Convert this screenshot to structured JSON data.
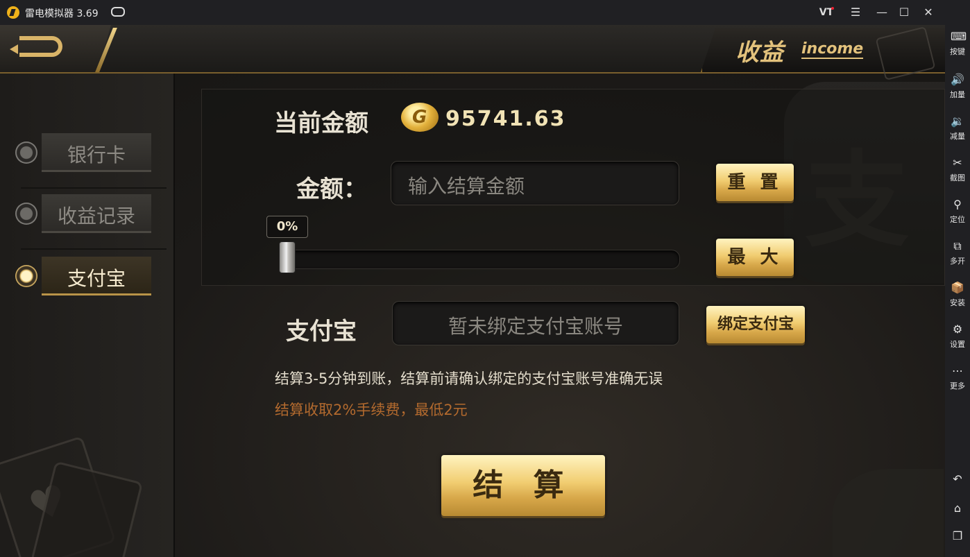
{
  "window": {
    "title": "雷电模拟器 3.69",
    "vt_label": "VT"
  },
  "sidebar": {
    "items": [
      {
        "label": "按键",
        "icon": "keyboard-icon"
      },
      {
        "label": "加量",
        "icon": "volume-up-icon"
      },
      {
        "label": "减量",
        "icon": "volume-down-icon"
      },
      {
        "label": "截图",
        "icon": "scissors-icon"
      },
      {
        "label": "定位",
        "icon": "location-pin-icon"
      },
      {
        "label": "多开",
        "icon": "multi-instance-icon"
      },
      {
        "label": "安装",
        "icon": "apk-install-icon"
      },
      {
        "label": "设置",
        "icon": "gear-icon"
      },
      {
        "label": "更多",
        "icon": "more-dots-icon"
      }
    ],
    "nav": [
      "back-icon",
      "home-icon",
      "recent-apps-icon"
    ]
  },
  "header": {
    "title_cn": "收益",
    "title_en": "income"
  },
  "tabs": [
    {
      "label": "银行卡",
      "active": false
    },
    {
      "label": "收益记录",
      "active": false
    },
    {
      "label": "支付宝",
      "active": true
    }
  ],
  "watermark_char": "支",
  "balance": {
    "label": "当前金额",
    "value": "95741.63"
  },
  "amount": {
    "label": "金额：",
    "placeholder": "输入结算金额",
    "reset_label": "重 置",
    "max_label": "最 大",
    "slider_percent_label": "0%",
    "slider_value": 0
  },
  "alipay": {
    "label": "支付宝",
    "account_text": "暂未绑定支付宝账号",
    "bind_label": "绑定支付宝"
  },
  "notes": {
    "info": "结算3-5分钟到账，结算前请确认绑定的支付宝账号准确无误",
    "fee": "结算收取2%手续费，最低2元"
  },
  "settle_label": "结 算",
  "colors": {
    "gold": "#e3c27c",
    "fee_text": "#b36a2e"
  }
}
